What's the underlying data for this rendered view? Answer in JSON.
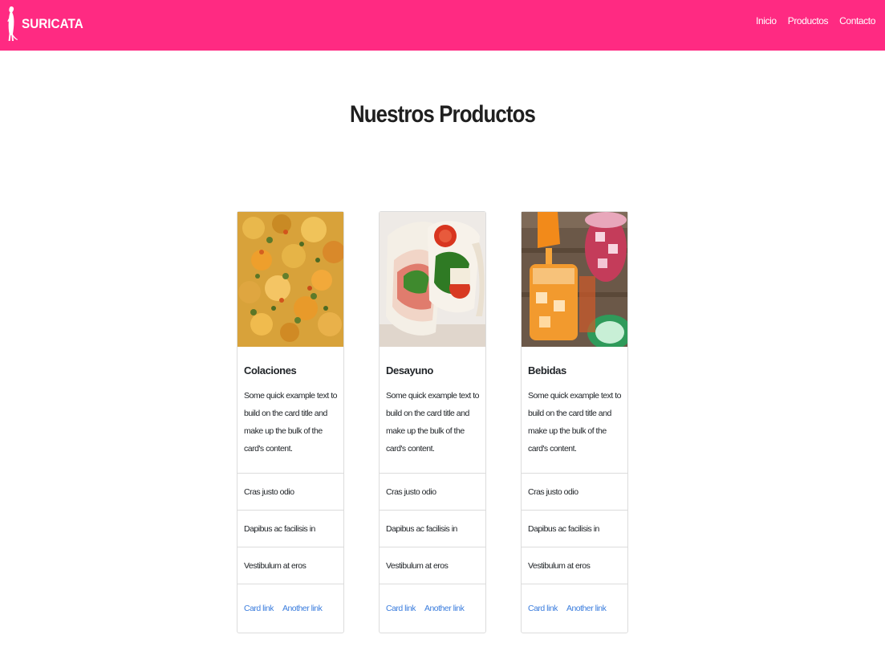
{
  "navbar": {
    "brand": "SURICATA",
    "links": [
      "Inicio",
      "Productos",
      "Contacto"
    ],
    "color": "#ff2a82"
  },
  "page": {
    "title": "Nuestros Productos"
  },
  "cards": [
    {
      "image": "food-dish-image",
      "title": "Colaciones",
      "text": "Some quick example text to build on the card title and make up the bulk of the card's content.",
      "items": [
        "Cras justo odio",
        "Dapibus ac facilisis in",
        "Vestibulum at eros"
      ],
      "links": [
        "Card link",
        "Another link"
      ]
    },
    {
      "image": "sandwich-image",
      "title": "Desayuno",
      "text": "Some quick example text to build on the card title and make up the bulk of the card's content.",
      "items": [
        "Cras justo odio",
        "Dapibus ac facilisis in",
        "Vestibulum at eros"
      ],
      "links": [
        "Card link",
        "Another link"
      ]
    },
    {
      "image": "drinks-image",
      "title": "Bebidas",
      "text": "Some quick example text to build on the card title and make up the bulk of the card's content.",
      "items": [
        "Cras justo odio",
        "Dapibus ac facilisis in",
        "Vestibulum at eros"
      ],
      "links": [
        "Card link",
        "Another link"
      ]
    }
  ],
  "colors": {
    "link": "#3b7ddd",
    "border": "#dcdcdc"
  }
}
